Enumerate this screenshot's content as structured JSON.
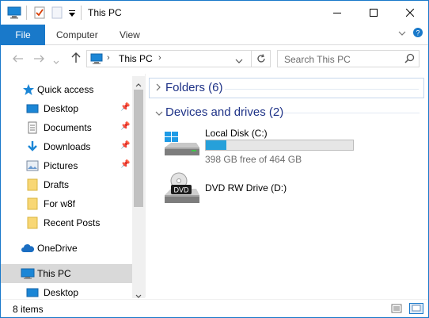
{
  "window": {
    "title": "This PC"
  },
  "ribbon": {
    "tabs": [
      "File",
      "Computer",
      "View"
    ]
  },
  "address": {
    "breadcrumb": [
      "This PC"
    ],
    "search_placeholder": "Search This PC"
  },
  "nav": {
    "items": [
      {
        "label": "Quick access",
        "icon": "star-icon",
        "pinned": false
      },
      {
        "label": "Desktop",
        "icon": "desktop-icon",
        "pinned": true
      },
      {
        "label": "Documents",
        "icon": "documents-icon",
        "pinned": true
      },
      {
        "label": "Downloads",
        "icon": "downloads-icon",
        "pinned": true
      },
      {
        "label": "Pictures",
        "icon": "pictures-icon",
        "pinned": true
      },
      {
        "label": "Drafts",
        "icon": "folder-icon",
        "pinned": false
      },
      {
        "label": "For w8f",
        "icon": "folder-icon",
        "pinned": false
      },
      {
        "label": "Recent Posts",
        "icon": "folder-icon",
        "pinned": false
      },
      {
        "label": "OneDrive",
        "icon": "cloud-icon",
        "pinned": false
      },
      {
        "label": "This PC",
        "icon": "computer-icon",
        "pinned": false,
        "selected": true
      },
      {
        "label": "Desktop",
        "icon": "desktop-icon",
        "pinned": false
      }
    ]
  },
  "content": {
    "groups": [
      {
        "title": "Folders (6)",
        "expanded": false
      },
      {
        "title": "Devices and drives (2)",
        "expanded": true
      }
    ],
    "drives": [
      {
        "name": "Local Disk (C:)",
        "subtitle": "398 GB free of 464 GB",
        "used_fraction": 0.142,
        "icon": "hard-drive-icon"
      },
      {
        "name": "DVD RW Drive (D:)",
        "icon": "dvd-drive-icon",
        "badge": "DVD"
      }
    ]
  },
  "status": {
    "item_count": "8 items"
  },
  "colors": {
    "accent": "#1979ca",
    "group_title": "#1e3287",
    "progress": "#26a0da",
    "selected_bg": "#d9d9d9"
  }
}
